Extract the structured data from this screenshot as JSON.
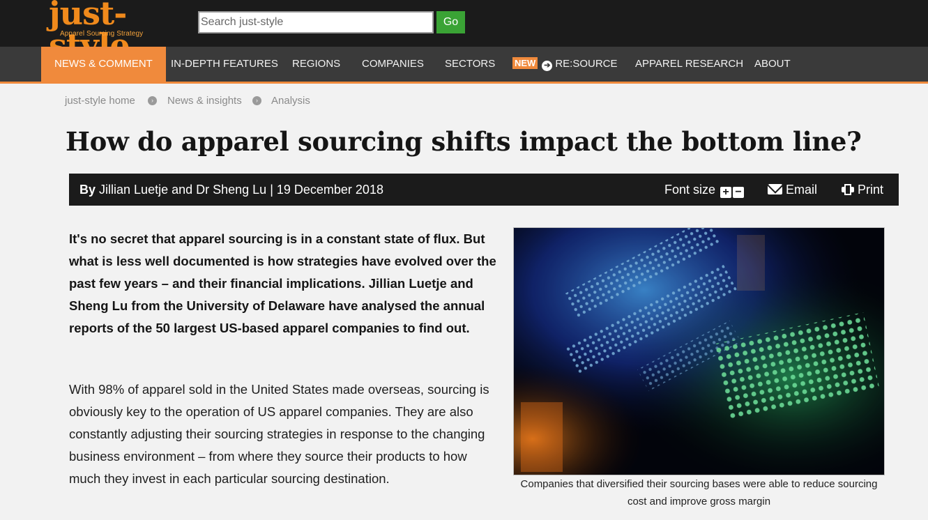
{
  "logo": {
    "main": "just-style",
    "tagline": "Apparel Sourcing Strategy"
  },
  "search": {
    "placeholder": "Search just-style",
    "go_label": "Go"
  },
  "nav": {
    "items": [
      {
        "label": "NEWS & COMMENT",
        "active": true
      },
      {
        "label": "IN-DEPTH FEATURES"
      },
      {
        "label": "REGIONS"
      },
      {
        "label": "COMPANIES"
      },
      {
        "label": "SECTORS"
      },
      {
        "label": "RE:SOURCE",
        "badge": "NEW"
      },
      {
        "label": "APPAREL RESEARCH"
      },
      {
        "label": "ABOUT"
      }
    ]
  },
  "breadcrumb": [
    "just-style home",
    "News & insights",
    "Analysis"
  ],
  "article": {
    "title": "How do apparel sourcing shifts impact the bottom line?",
    "byline_prefix": "By",
    "byline": "Jillian Luetje and Dr Sheng Lu | 19 December 2018",
    "tools": {
      "font_size": "Font size",
      "email": "Email",
      "print": "Print"
    },
    "lead": "It's no secret that apparel sourcing is in a constant state of flux. But what is less well documented is how strategies have evolved over the past few years – and their financial implications. Jillian Luetje and Sheng Lu from the University of Delaware have analysed the annual reports of the 50 largest US-based apparel companies to find out.",
    "body": "With 98% of apparel sold in the United States made overseas, sourcing is obviously key to the operation of US apparel companies. They are also constantly adjusting their sourcing strategies in response to the changing business environment – from where they source their products to how much they invest in each particular sourcing destination.",
    "image_caption": "Companies that diversified their sourcing bases were able to reduce sourcing cost and improve gross margin"
  },
  "colors": {
    "accent": "#f08a3c",
    "topbar": "#1b1b1b",
    "navbar": "#3a3a3a",
    "go_button": "#3aa335"
  }
}
